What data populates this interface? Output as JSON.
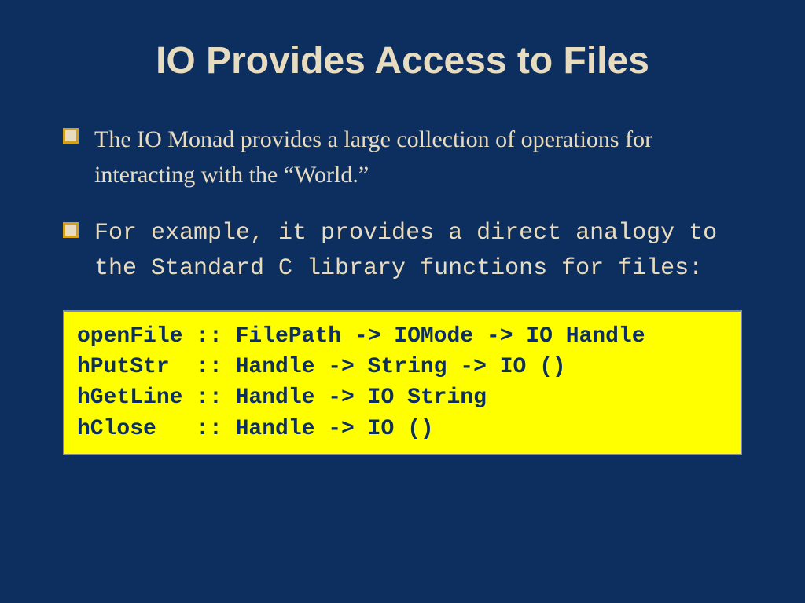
{
  "title": "IO Provides Access to Files",
  "bullets": [
    {
      "text": "The IO Monad provides a large collection of operations for interacting with the “World.”",
      "mono": false
    },
    {
      "text": "For example, it provides a direct analogy to the Standard C library functions for files:",
      "mono": true
    }
  ],
  "code": "openFile :: FilePath -> IOMode -> IO Handle\nhPutStr  :: Handle -> String -> IO ()\nhGetLine :: Handle -> IO String\nhClose   :: Handle -> IO ()"
}
